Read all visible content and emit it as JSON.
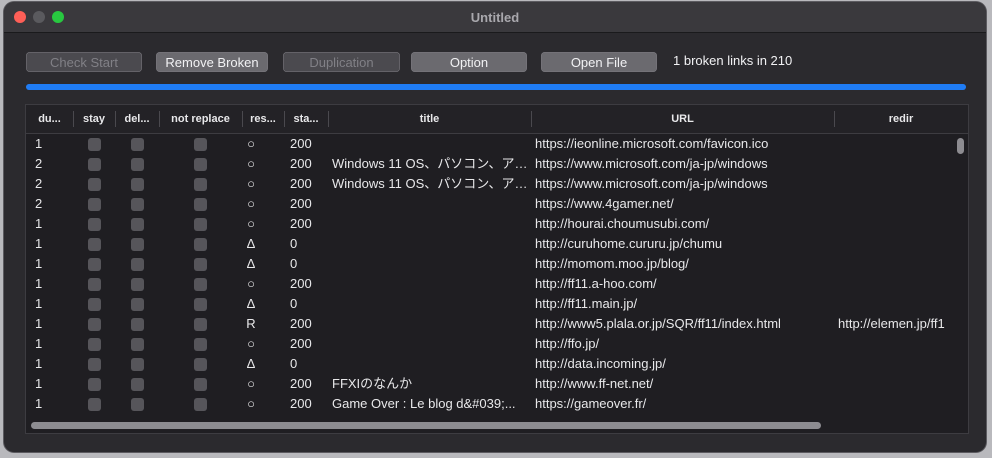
{
  "window": {
    "title": "Untitled"
  },
  "toolbar": {
    "check_start": "Check Start",
    "remove_broken": "Remove Broken",
    "duplication": "Duplication",
    "option": "Option",
    "open_file": "Open File",
    "status": "1 broken links in 210"
  },
  "progress": {
    "fraction": 1.0,
    "color": "#1f7cf5"
  },
  "table": {
    "columns": [
      "du...",
      "stay",
      "del...",
      "not replace",
      "res...",
      "sta...",
      "title",
      "URL",
      "redir"
    ],
    "rows": [
      {
        "dup": "1",
        "result": "○",
        "status": "200",
        "title": "",
        "url": "https://ieonline.microsoft.com/favicon.ico",
        "redirect": ""
      },
      {
        "dup": "2",
        "result": "○",
        "status": "200",
        "title": "Windows 11 OS、パソコン、ア…",
        "url": "https://www.microsoft.com/ja-jp/windows",
        "redirect": ""
      },
      {
        "dup": "2",
        "result": "○",
        "status": "200",
        "title": "Windows 11 OS、パソコン、ア…",
        "url": "https://www.microsoft.com/ja-jp/windows",
        "redirect": ""
      },
      {
        "dup": "2",
        "result": "○",
        "status": "200",
        "title": "",
        "url": "https://www.4gamer.net/",
        "redirect": ""
      },
      {
        "dup": "1",
        "result": "○",
        "status": "200",
        "title": "",
        "url": "http://hourai.choumusubi.com/",
        "redirect": ""
      },
      {
        "dup": "1",
        "result": "Δ",
        "status": "0",
        "title": "",
        "url": "http://curuhome.cururu.jp/chumu",
        "redirect": ""
      },
      {
        "dup": "1",
        "result": "Δ",
        "status": "0",
        "title": "",
        "url": "http://momom.moo.jp/blog/",
        "redirect": ""
      },
      {
        "dup": "1",
        "result": "○",
        "status": "200",
        "title": "",
        "url": "http://ff11.a-hoo.com/",
        "redirect": ""
      },
      {
        "dup": "1",
        "result": "Δ",
        "status": "0",
        "title": "",
        "url": "http://ff11.main.jp/",
        "redirect": ""
      },
      {
        "dup": "1",
        "result": "R",
        "status": "200",
        "title": "",
        "url": "http://www5.plala.or.jp/SQR/ff11/index.html",
        "redirect": "http://elemen.jp/ff1"
      },
      {
        "dup": "1",
        "result": "○",
        "status": "200",
        "title": "",
        "url": "http://ffo.jp/",
        "redirect": ""
      },
      {
        "dup": "1",
        "result": "Δ",
        "status": "0",
        "title": "",
        "url": "http://data.incoming.jp/",
        "redirect": ""
      },
      {
        "dup": "1",
        "result": "○",
        "status": "200",
        "title": "FFXIのなんか",
        "url": "http://www.ff-net.net/",
        "redirect": ""
      },
      {
        "dup": "1",
        "result": "○",
        "status": "200",
        "title": "Game Over : Le blog d&#039;...",
        "url": "https://gameover.fr/",
        "redirect": ""
      }
    ]
  }
}
